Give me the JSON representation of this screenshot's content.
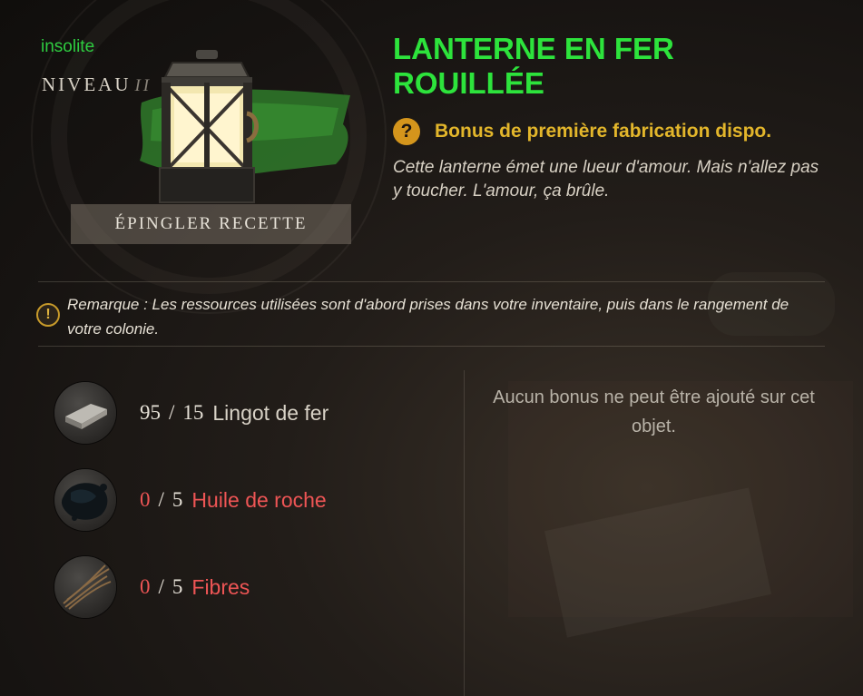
{
  "item": {
    "rarity": "insolite",
    "level_label": "NIVEAU",
    "level_value": "II",
    "pin_button": "ÉPINGLER RECETTE",
    "title": "LANTERNE EN FER ROUILLÉE",
    "bonus_text": "Bonus de première fabrication dispo.",
    "description": "Cette lanterne émet une lueur d'amour. Mais n'allez pas y toucher. L'amour, ça brûle."
  },
  "remark": {
    "text": "Remarque : Les ressources utilisées sont d'abord prises dans votre inventaire, puis dans le rangement de votre colonie."
  },
  "resources": [
    {
      "have": "95",
      "need": "15",
      "name": "Lingot de fer",
      "sufficient": true,
      "icon": "iron-ingot-icon"
    },
    {
      "have": "0",
      "need": "5",
      "name": "Huile de roche",
      "sufficient": false,
      "icon": "rock-oil-icon"
    },
    {
      "have": "0",
      "need": "5",
      "name": "Fibres",
      "sufficient": false,
      "icon": "fibers-icon"
    }
  ],
  "no_bonus_text": "Aucun bonus ne peut être ajouté sur cet objet.",
  "colors": {
    "rarity_green": "#2ecc40",
    "title_green": "#2de33c",
    "bonus_gold": "#e3b62b",
    "insufficient_red": "#f05a5a"
  }
}
